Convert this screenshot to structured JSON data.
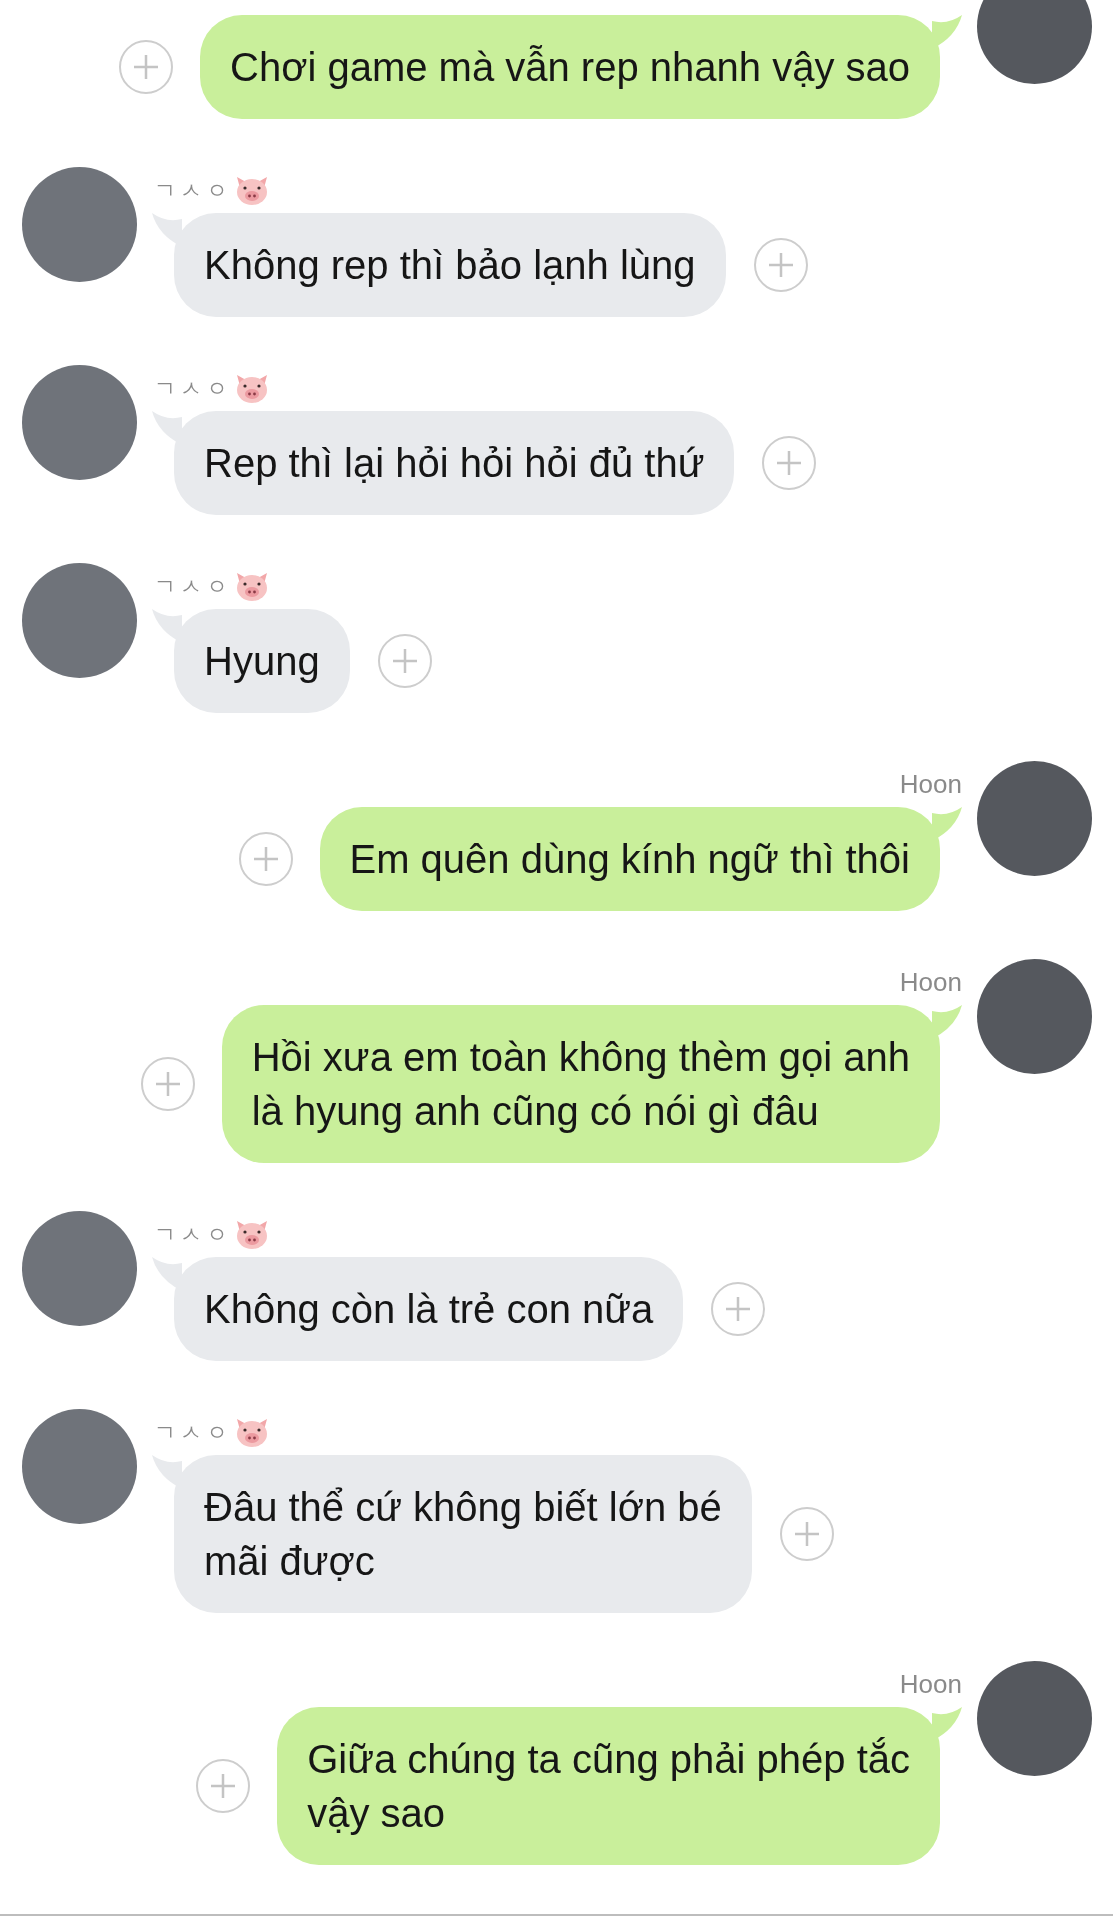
{
  "messages": [
    {
      "kind": "sent",
      "text": "Chơi game mà vẫn rep nhanh vậy sao"
    },
    {
      "kind": "received",
      "sender": "ㄱㅅㅇ",
      "text": "Không rep thì bảo lạnh lùng"
    },
    {
      "kind": "received",
      "sender": "ㄱㅅㅇ",
      "text": "Rep thì lại hỏi hỏi hỏi đủ thứ"
    },
    {
      "kind": "received",
      "sender": "ㄱㅅㅇ",
      "text": "Hyung"
    },
    {
      "kind": "sent",
      "sender": "Hoon",
      "text": "Em quên dùng kính ngữ thì thôi"
    },
    {
      "kind": "sent",
      "sender": "Hoon",
      "text": "Hồi xưa em toàn không thèm gọi anh\nlà hyung anh cũng có nói gì đâu"
    },
    {
      "kind": "received",
      "sender": "ㄱㅅㅇ",
      "text": "Không còn là trẻ con nữa"
    },
    {
      "kind": "received",
      "sender": "ㄱㅅㅇ",
      "text": "Đâu thể cứ không biết lớn bé\nmãi được"
    },
    {
      "kind": "sent",
      "sender": "Hoon",
      "text": "Giữa chúng ta cũng phải phép tắc\nvậy sao"
    }
  ]
}
